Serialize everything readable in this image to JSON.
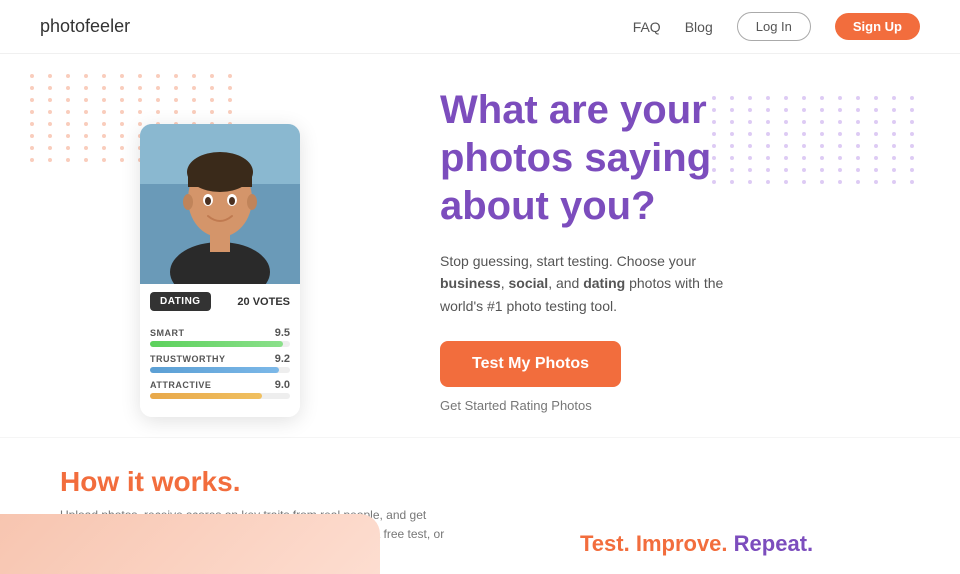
{
  "nav": {
    "logo": "photofeeler",
    "links": [
      {
        "label": "FAQ",
        "id": "faq"
      },
      {
        "label": "Blog",
        "id": "blog"
      }
    ],
    "login_label": "Log In",
    "signup_label": "Sign Up"
  },
  "hero": {
    "tab_label": "DATING",
    "votes_count": "20",
    "votes_suffix": "VOTES",
    "bars": [
      {
        "label": "SMART",
        "score": "9.5",
        "width": "95",
        "type": "green"
      },
      {
        "label": "TRUSTWORTHY",
        "score": "9.2",
        "width": "92",
        "type": "blue"
      },
      {
        "label": "ATTRACTIVE",
        "score": "9.0",
        "width": "80",
        "type": "orange"
      }
    ],
    "headline_line1": "What are your",
    "headline_line2": "photos saying",
    "headline_line3": "about you?",
    "desc_pre": "Stop guessing, start testing. Choose your ",
    "desc_bold1": "business",
    "desc_mid": ", ",
    "desc_bold2": "social",
    "desc_post": ", and ",
    "desc_bold3": "dating",
    "desc_end": " photos with the world's #1 photo testing tool.",
    "cta_label": "Test My Photos",
    "get_started": "Get Started Rating Photos"
  },
  "how": {
    "title": "How it works.",
    "desc": "Upload photos, receive scores on key traits from real people, and get feedback to improve your online image. Vote on photos for a free test, or purchase credits for faster results!"
  },
  "bottom": {
    "tagline_1": "Test. Improve.",
    "tagline_2": " Repeat."
  }
}
